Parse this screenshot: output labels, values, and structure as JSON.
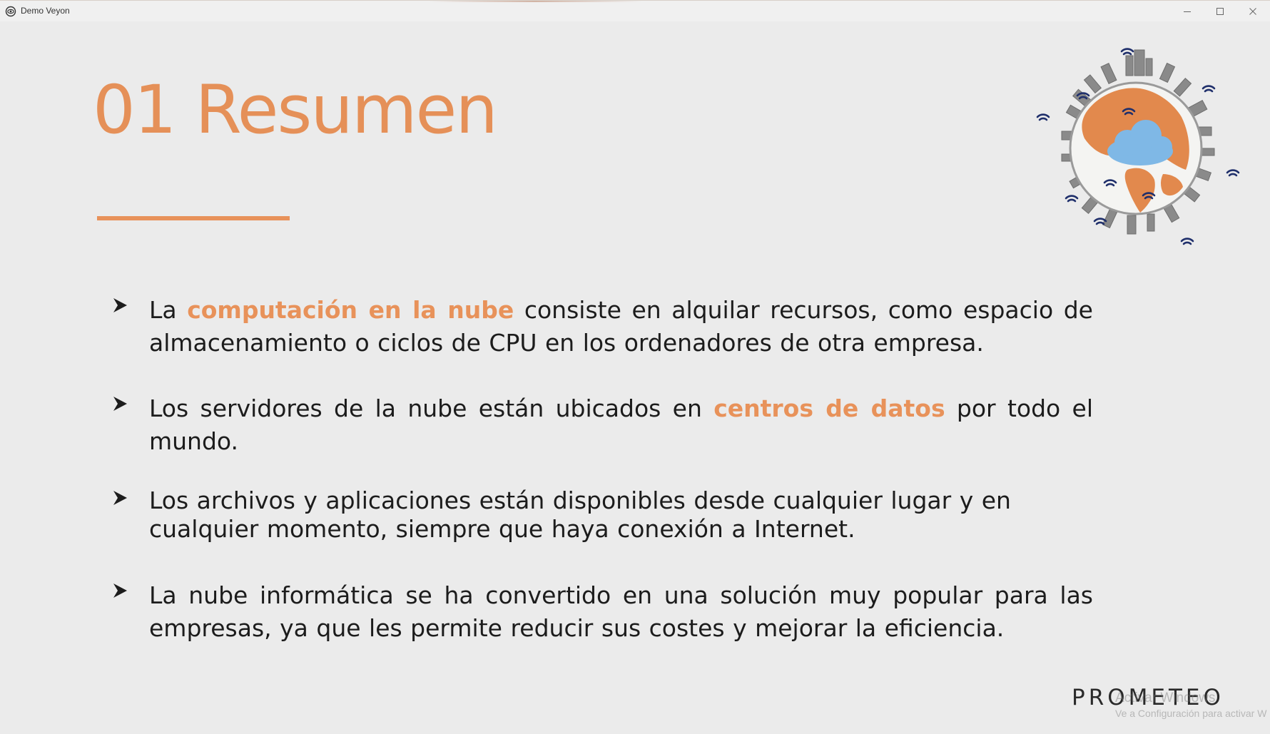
{
  "window": {
    "title": "Demo Veyon",
    "controls": {
      "minimize_icon": "minimize-icon",
      "maximize_icon": "maximize-icon",
      "close_icon": "close-icon"
    }
  },
  "slide": {
    "title": "01 Resumen",
    "accent_color": "#e8925a",
    "bullets": [
      {
        "parts": [
          {
            "text": "La ",
            "highlight": false
          },
          {
            "text": "computación en la nube",
            "highlight": true
          },
          {
            "text": " consiste en alquilar recursos, como espacio de almacenamiento o ciclos de CPU en los ordenadores de otra empresa.",
            "highlight": false
          }
        ]
      },
      {
        "parts": [
          {
            "text": "Los servidores de la nube están ubicados en ",
            "highlight": false
          },
          {
            "text": "centros de datos",
            "highlight": true
          },
          {
            "text": " por todo el mundo.",
            "highlight": false
          }
        ]
      },
      {
        "parts": [
          {
            "text": "Los archivos y aplicaciones están disponibles desde cualquier lugar y en cualquier momento, siempre que haya conexión a Internet.",
            "highlight": false
          }
        ]
      },
      {
        "parts": [
          {
            "text": "La nube informática se ha convertido en una solución muy popular para las empresas, ya que les permite reducir sus costes y mejorar la eficiencia.",
            "highlight": false
          }
        ]
      }
    ],
    "illustration": "globe-cloud-wifi-icon",
    "logo": "PROMETEO"
  },
  "watermark": {
    "line1": "Activar Windows",
    "line2": "Ve a Configuración para activar W"
  }
}
